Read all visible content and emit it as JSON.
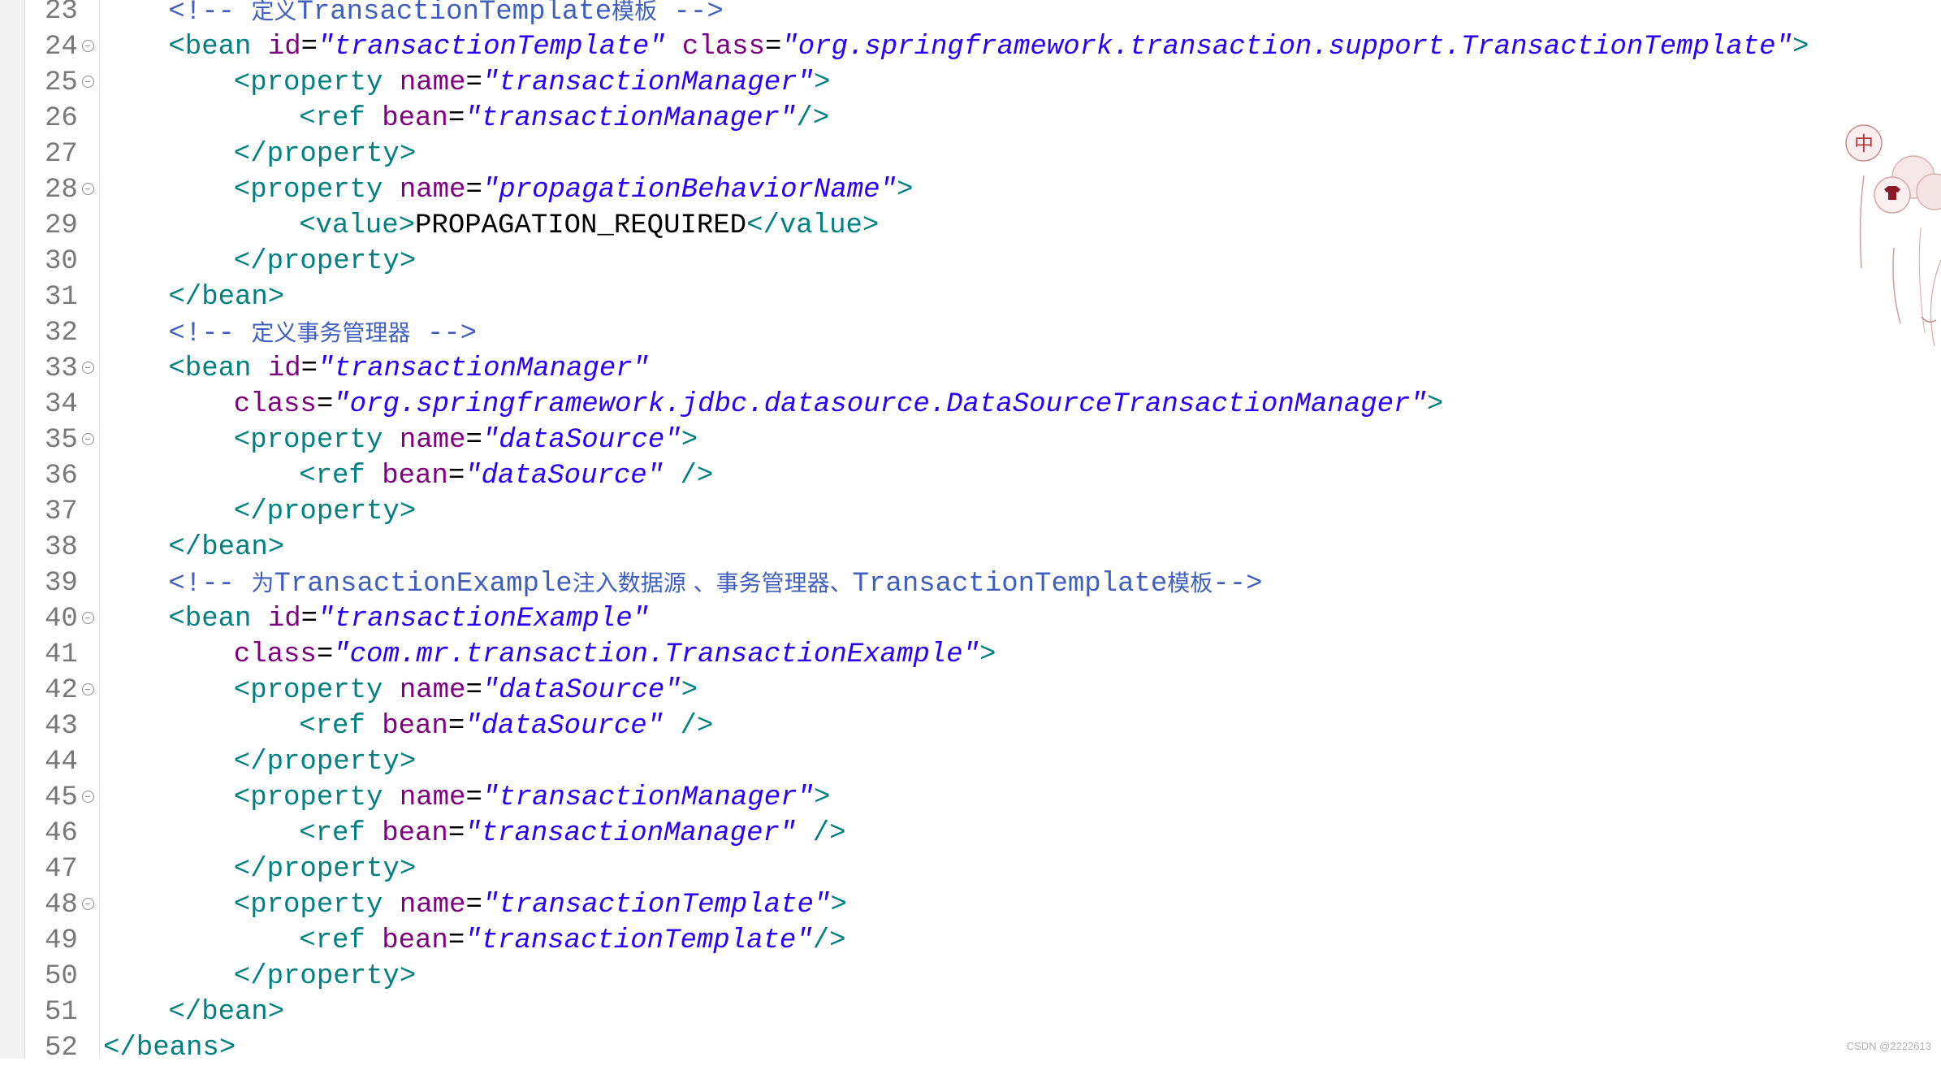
{
  "editor": {
    "lines": [
      {
        "num": "23",
        "fold": false,
        "indent": 2,
        "tokens": [
          {
            "k": "c",
            "v": "<!-- "
          },
          {
            "k": "c",
            "v": "定义"
          },
          {
            "k": "c",
            "v": "TransactionTemplate"
          },
          {
            "k": "c",
            "v": "模板"
          },
          {
            "k": "c",
            "v": " -->"
          }
        ]
      },
      {
        "num": "24",
        "fold": true,
        "indent": 2,
        "tokens": [
          {
            "k": "t",
            "v": "<bean "
          },
          {
            "k": "a",
            "v": "id"
          },
          {
            "k": "p",
            "v": "="
          },
          {
            "k": "s",
            "v": "\"transactionTemplate\""
          },
          {
            "k": "p",
            "v": " "
          },
          {
            "k": "a",
            "v": "class"
          },
          {
            "k": "p",
            "v": "="
          },
          {
            "k": "s",
            "v": "\"org.springframework.transaction.support.TransactionTemplate\""
          },
          {
            "k": "t",
            "v": ">"
          }
        ]
      },
      {
        "num": "25",
        "fold": true,
        "indent": 4,
        "tokens": [
          {
            "k": "t",
            "v": "<property "
          },
          {
            "k": "a",
            "v": "name"
          },
          {
            "k": "p",
            "v": "="
          },
          {
            "k": "s",
            "v": "\"transactionManager\""
          },
          {
            "k": "t",
            "v": ">"
          }
        ]
      },
      {
        "num": "26",
        "fold": false,
        "indent": 6,
        "tokens": [
          {
            "k": "t",
            "v": "<ref "
          },
          {
            "k": "a",
            "v": "bean"
          },
          {
            "k": "p",
            "v": "="
          },
          {
            "k": "s",
            "v": "\"transactionManager\""
          },
          {
            "k": "t",
            "v": "/>"
          }
        ]
      },
      {
        "num": "27",
        "fold": false,
        "indent": 4,
        "tokens": [
          {
            "k": "t",
            "v": "</property>"
          }
        ]
      },
      {
        "num": "28",
        "fold": true,
        "indent": 4,
        "tokens": [
          {
            "k": "t",
            "v": "<property "
          },
          {
            "k": "a",
            "v": "name"
          },
          {
            "k": "p",
            "v": "="
          },
          {
            "k": "s",
            "v": "\"propagationBehaviorName\""
          },
          {
            "k": "t",
            "v": ">"
          }
        ]
      },
      {
        "num": "29",
        "fold": false,
        "indent": 6,
        "tokens": [
          {
            "k": "t",
            "v": "<value>"
          },
          {
            "k": "x",
            "v": "PROPAGATION_REQUIRED"
          },
          {
            "k": "t",
            "v": "</value>"
          }
        ]
      },
      {
        "num": "30",
        "fold": false,
        "indent": 4,
        "tokens": [
          {
            "k": "t",
            "v": "</property>"
          }
        ]
      },
      {
        "num": "31",
        "fold": false,
        "indent": 2,
        "tokens": [
          {
            "k": "t",
            "v": "</bean>"
          }
        ]
      },
      {
        "num": "32",
        "fold": false,
        "indent": 2,
        "tokens": [
          {
            "k": "c",
            "v": "<!-- "
          },
          {
            "k": "c",
            "v": "定义事务管理器"
          },
          {
            "k": "c",
            "v": " -->"
          }
        ]
      },
      {
        "num": "33",
        "fold": true,
        "indent": 2,
        "tokens": [
          {
            "k": "t",
            "v": "<bean "
          },
          {
            "k": "a",
            "v": "id"
          },
          {
            "k": "p",
            "v": "="
          },
          {
            "k": "s",
            "v": "\"transactionManager\""
          }
        ]
      },
      {
        "num": "34",
        "fold": false,
        "indent": 4,
        "tokens": [
          {
            "k": "a",
            "v": "class"
          },
          {
            "k": "p",
            "v": "="
          },
          {
            "k": "s",
            "v": "\"org.springframework.jdbc.datasource.DataSourceTransactionManager\""
          },
          {
            "k": "t",
            "v": ">"
          }
        ]
      },
      {
        "num": "35",
        "fold": true,
        "indent": 4,
        "tokens": [
          {
            "k": "t",
            "v": "<property "
          },
          {
            "k": "a",
            "v": "name"
          },
          {
            "k": "p",
            "v": "="
          },
          {
            "k": "s",
            "v": "\"dataSource\""
          },
          {
            "k": "t",
            "v": ">"
          }
        ]
      },
      {
        "num": "36",
        "fold": false,
        "indent": 6,
        "tokens": [
          {
            "k": "t",
            "v": "<ref "
          },
          {
            "k": "a",
            "v": "bean"
          },
          {
            "k": "p",
            "v": "="
          },
          {
            "k": "s",
            "v": "\"dataSource\""
          },
          {
            "k": "p",
            "v": " "
          },
          {
            "k": "t",
            "v": "/>"
          }
        ]
      },
      {
        "num": "37",
        "fold": false,
        "indent": 4,
        "tokens": [
          {
            "k": "t",
            "v": "</property>"
          }
        ]
      },
      {
        "num": "38",
        "fold": false,
        "indent": 2,
        "tokens": [
          {
            "k": "t",
            "v": "</bean>"
          }
        ]
      },
      {
        "num": "39",
        "fold": false,
        "indent": 2,
        "tokens": [
          {
            "k": "c",
            "v": "<!-- "
          },
          {
            "k": "c",
            "v": "为"
          },
          {
            "k": "c",
            "v": "TransactionExample"
          },
          {
            "k": "c",
            "v": "注入数据源 、事务管理器、"
          },
          {
            "k": "c",
            "v": "TransactionTemplate"
          },
          {
            "k": "c",
            "v": "模板"
          },
          {
            "k": "c",
            "v": "-->"
          }
        ]
      },
      {
        "num": "40",
        "fold": true,
        "indent": 2,
        "tokens": [
          {
            "k": "t",
            "v": "<bean "
          },
          {
            "k": "a",
            "v": "id"
          },
          {
            "k": "p",
            "v": "="
          },
          {
            "k": "s",
            "v": "\"transactionExample\""
          }
        ]
      },
      {
        "num": "41",
        "fold": false,
        "indent": 4,
        "tokens": [
          {
            "k": "a",
            "v": "class"
          },
          {
            "k": "p",
            "v": "="
          },
          {
            "k": "s",
            "v": "\"com.mr.transaction.TransactionExample\""
          },
          {
            "k": "t",
            "v": ">"
          }
        ]
      },
      {
        "num": "42",
        "fold": true,
        "indent": 4,
        "tokens": [
          {
            "k": "t",
            "v": "<property "
          },
          {
            "k": "a",
            "v": "name"
          },
          {
            "k": "p",
            "v": "="
          },
          {
            "k": "s",
            "v": "\"dataSource\""
          },
          {
            "k": "t",
            "v": ">"
          }
        ]
      },
      {
        "num": "43",
        "fold": false,
        "indent": 6,
        "tokens": [
          {
            "k": "t",
            "v": "<ref "
          },
          {
            "k": "a",
            "v": "bean"
          },
          {
            "k": "p",
            "v": "="
          },
          {
            "k": "s",
            "v": "\"dataSource\""
          },
          {
            "k": "p",
            "v": " "
          },
          {
            "k": "t",
            "v": "/>"
          }
        ]
      },
      {
        "num": "44",
        "fold": false,
        "indent": 4,
        "tokens": [
          {
            "k": "t",
            "v": "</property>"
          }
        ]
      },
      {
        "num": "45",
        "fold": true,
        "indent": 4,
        "tokens": [
          {
            "k": "t",
            "v": "<property "
          },
          {
            "k": "a",
            "v": "name"
          },
          {
            "k": "p",
            "v": "="
          },
          {
            "k": "s",
            "v": "\"transactionManager\""
          },
          {
            "k": "t",
            "v": ">"
          }
        ]
      },
      {
        "num": "46",
        "fold": false,
        "indent": 6,
        "tokens": [
          {
            "k": "t",
            "v": "<ref "
          },
          {
            "k": "a",
            "v": "bean"
          },
          {
            "k": "p",
            "v": "="
          },
          {
            "k": "s",
            "v": "\"transactionManager\""
          },
          {
            "k": "p",
            "v": " "
          },
          {
            "k": "t",
            "v": "/>"
          }
        ]
      },
      {
        "num": "47",
        "fold": false,
        "indent": 4,
        "tokens": [
          {
            "k": "t",
            "v": "</property>"
          }
        ]
      },
      {
        "num": "48",
        "fold": true,
        "indent": 4,
        "tokens": [
          {
            "k": "t",
            "v": "<property "
          },
          {
            "k": "a",
            "v": "name"
          },
          {
            "k": "p",
            "v": "="
          },
          {
            "k": "s",
            "v": "\"transactionTemplate\""
          },
          {
            "k": "t",
            "v": ">"
          }
        ]
      },
      {
        "num": "49",
        "fold": false,
        "indent": 6,
        "tokens": [
          {
            "k": "t",
            "v": "<ref "
          },
          {
            "k": "a",
            "v": "bean"
          },
          {
            "k": "p",
            "v": "="
          },
          {
            "k": "s",
            "v": "\"transactionTemplate\""
          },
          {
            "k": "t",
            "v": "/>"
          }
        ]
      },
      {
        "num": "50",
        "fold": false,
        "indent": 4,
        "tokens": [
          {
            "k": "t",
            "v": "</property>"
          }
        ]
      },
      {
        "num": "51",
        "fold": false,
        "indent": 2,
        "tokens": [
          {
            "k": "t",
            "v": "</bean>"
          }
        ]
      },
      {
        "num": "52",
        "fold": false,
        "indent": 0,
        "tokens": [
          {
            "k": "t",
            "v": "</beans>"
          }
        ]
      }
    ]
  },
  "decoration": {
    "badge_text": "中"
  },
  "watermark": "CSDN @2222613",
  "colors": {
    "tag": "#008080",
    "attribute": "#7f007f",
    "string": "#2a00ff",
    "comment": "#3f5fbf",
    "text": "#000000",
    "line_number": "#787878",
    "badge": "#b04040"
  }
}
